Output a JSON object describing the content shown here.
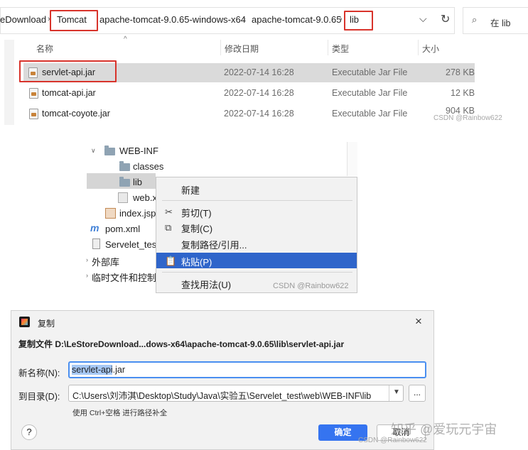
{
  "explorer": {
    "breadcrumbs": [
      "eDownload",
      "Tomcat",
      "apache-tomcat-9.0.65-windows-x64",
      "apache-tomcat-9.0.65",
      "lib"
    ],
    "search_placeholder": "在 lib",
    "columns": [
      "名称",
      "修改日期",
      "类型",
      "大小"
    ],
    "files": [
      {
        "name": "servlet-api.jar",
        "date": "2022-07-14 16:28",
        "type": "Executable Jar File",
        "size": "278 KB",
        "selected": true
      },
      {
        "name": "tomcat-api.jar",
        "date": "2022-07-14 16:28",
        "type": "Executable Jar File",
        "size": "12 KB",
        "selected": false
      },
      {
        "name": "tomcat-coyote.jar",
        "date": "2022-07-14 16:28",
        "type": "Executable Jar File",
        "size": "904 KB",
        "selected": false
      }
    ],
    "watermark": "CSDN @Rainbow622"
  },
  "ide": {
    "tree": [
      {
        "label": "WEB-INF"
      },
      {
        "label": "classes"
      },
      {
        "label": "lib"
      },
      {
        "label": "web.x"
      },
      {
        "label": "index.jsp"
      },
      {
        "label": "pom.xml"
      },
      {
        "label": "Servelet_tes"
      },
      {
        "label": "外部库"
      },
      {
        "label": "临时文件和控制"
      }
    ],
    "menu": {
      "new": "新建",
      "cut": "剪切(T)",
      "copy": "复制(C)",
      "copy_path": "复制路径/引用...",
      "paste": "粘贴(P)",
      "find_usages": "查找用法(U)"
    },
    "watermark": "CSDN @Rainbow622"
  },
  "dialog": {
    "title": "复制",
    "heading": "复制文件 D:\\LeStoreDownload...dows-x64\\apache-tomcat-9.0.65\\lib\\servlet-api.jar",
    "new_name_label": "新名称(N):",
    "new_name_value": "servlet-api.jar",
    "target_dir_label": "到目录(D):",
    "target_dir_value": "C:\\Users\\刘沛淇\\Desktop\\Study\\Java\\实验五\\Servelet_test\\web\\WEB-INF\\lib",
    "hint": "使用 Ctrl+空格 进行路径补全",
    "ok": "确定",
    "cancel": "取消",
    "browse": "...",
    "help": "?",
    "watermark_zhihu": "知乎 @爱玩元宇宙",
    "watermark_csdn": "CSDN @Rainbow622"
  }
}
